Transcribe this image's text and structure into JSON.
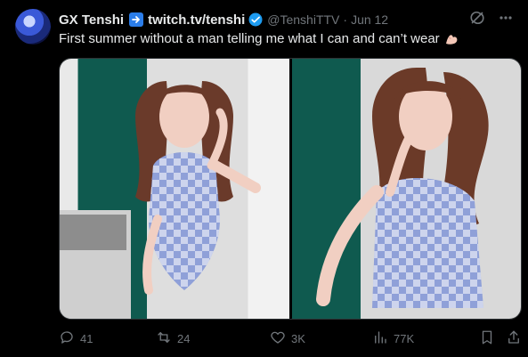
{
  "tweet": {
    "author_name": "GX Tenshi",
    "link_text": "twitch.tv/tenshi",
    "handle": "@TenshiTTV",
    "separator": "·",
    "date": "Jun 12",
    "text": "First summer without a man telling me what I can and can’t wear"
  },
  "actions": {
    "replies": "41",
    "retweets": "24",
    "likes": "3K",
    "views": "77K"
  },
  "icons": {
    "avatar": "avatar-image",
    "arrow": "right-arrow-icon",
    "verified": "verified-badge-icon",
    "grok": "grok-icon",
    "more": "more-icon",
    "emoji": "flexed-biceps-icon",
    "reply": "reply-icon",
    "retweet": "retweet-icon",
    "like": "heart-icon",
    "views": "views-icon",
    "bookmark": "bookmark-icon",
    "share": "share-icon"
  },
  "colors": {
    "accent": "#1d9bf0",
    "muted": "#71767b",
    "text": "#e7e9ea"
  }
}
